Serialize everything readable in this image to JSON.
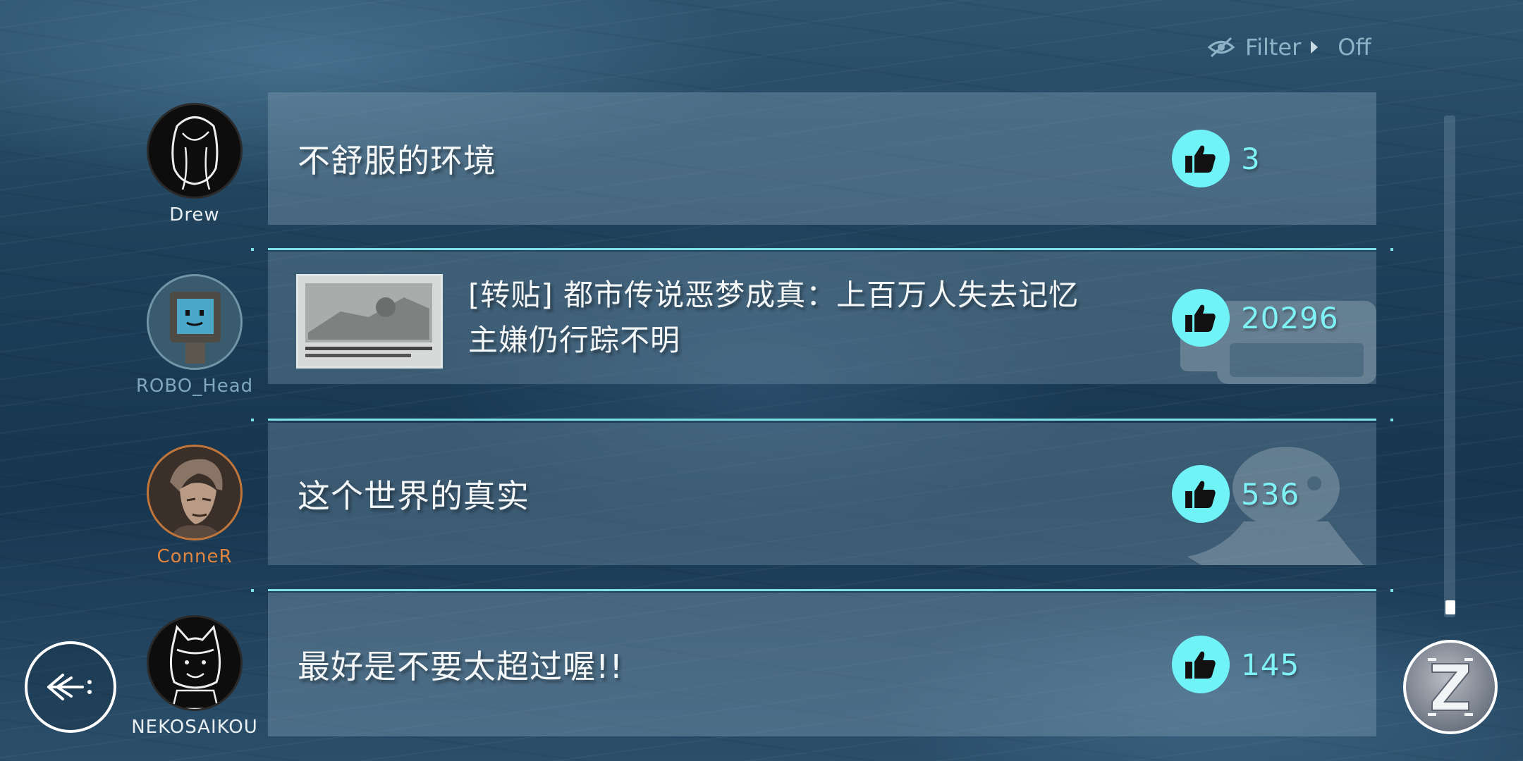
{
  "filter": {
    "label": "Filter",
    "value": "Off",
    "icon": "eye-slash-icon"
  },
  "threads": [
    {
      "user": "Drew",
      "title": "不舒服的环境",
      "likes": "3"
    },
    {
      "user": "ROBO_Head",
      "title_line1": "[转贴] 都市传说恶梦成真：上百万人失去记忆",
      "title_line2": "主嫌仍行踪不明",
      "likes": "20296"
    },
    {
      "user": "ConneR",
      "title": "这个世界的真实",
      "likes": "536"
    },
    {
      "user": "NEKOSAIKOU",
      "title": "最好是不要太超过喔!!",
      "likes": "145"
    }
  ],
  "colors": {
    "accent": "#6ff3f7",
    "conner_name": "#e0853f",
    "robo_name": "#7fa8bf"
  },
  "icons": {
    "like": "thumbs-up-icon",
    "back": "back-arrow-icon",
    "menu": "emblem-icon"
  }
}
